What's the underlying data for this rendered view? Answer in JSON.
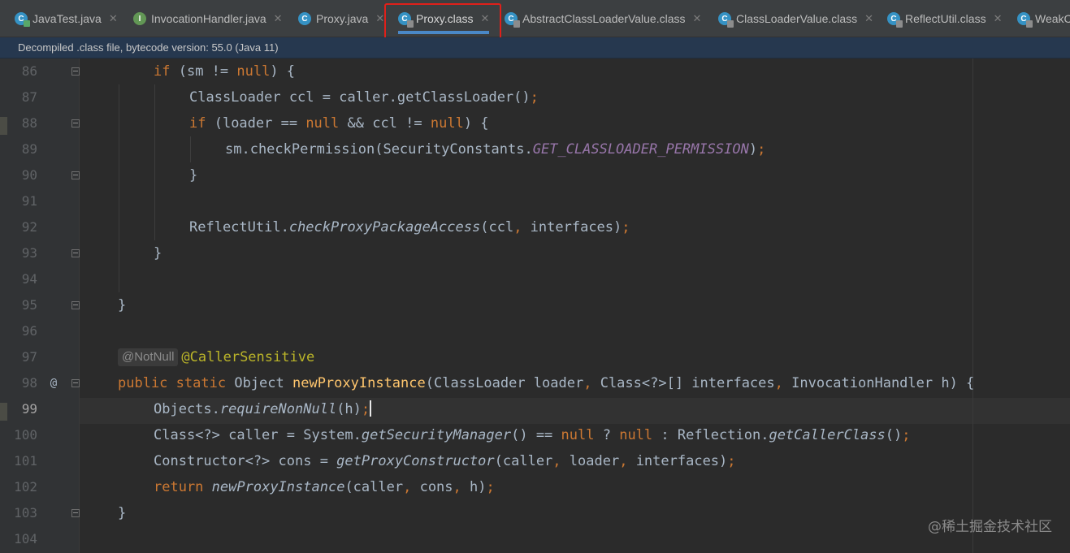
{
  "tabs": [
    {
      "label": "JavaTest.java",
      "icon": "class-file-icon"
    },
    {
      "label": "InvocationHandler.java",
      "icon": "interface-file-icon"
    },
    {
      "label": "Proxy.java",
      "icon": "class-file-icon"
    },
    {
      "label": "Proxy.class",
      "icon": "compiled-class-icon",
      "active": true
    },
    {
      "label": "AbstractClassLoaderValue.class",
      "icon": "compiled-class-icon"
    },
    {
      "label": "ClassLoaderValue.class",
      "icon": "compiled-class-icon"
    },
    {
      "label": "ReflectUtil.class",
      "icon": "compiled-class-icon"
    },
    {
      "label": "WeakC",
      "icon": "compiled-class-icon"
    }
  ],
  "banner": {
    "text": "Decompiled .class file, bytecode version: 55.0 (Java 11)"
  },
  "line_numbers": [
    "86",
    "87",
    "88",
    "89",
    "90",
    "91",
    "92",
    "93",
    "94",
    "95",
    "96",
    "97",
    "98",
    "99",
    "100",
    "101",
    "102",
    "103",
    "104"
  ],
  "current_line": "99",
  "gutter_marker": "@",
  "code": {
    "l86": {
      "kw_if": "if",
      "a": " (sm != ",
      "kw_null": "null",
      "b": ") {"
    },
    "l87": {
      "a": "ClassLoader ccl = caller.",
      "fn": "getClassLoader",
      "b": "()",
      "semi": ";"
    },
    "l88": {
      "kw_if": "if",
      "a": " (loader == ",
      "kw_null1": "null",
      "b": " && ccl != ",
      "kw_null2": "null",
      "c": ") {"
    },
    "l89": {
      "a": "sm.checkPermission(SecurityConstants.",
      "const": "GET_CLASSLOADER_PERMISSION",
      "b": ")",
      "semi": ";"
    },
    "l90": {
      "a": "}"
    },
    "l92": {
      "a": "ReflectUtil.",
      "fn": "checkProxyPackageAccess",
      "b": "(ccl",
      "comma": ",",
      "c": " interfaces)",
      "semi": ";"
    },
    "l93": {
      "a": "}"
    },
    "l95": {
      "a": "}"
    },
    "l97": {
      "hint": "@NotNull",
      "ann": "@CallerSensitive"
    },
    "l98": {
      "kw1": "public",
      "kw2": "static",
      "a": " Object ",
      "fn": "newProxyInstance",
      "b": "(ClassLoader loader",
      "c1": ",",
      "c": " Class<?>[] interfaces",
      "c2": ",",
      "d": " InvocationHandler h) {"
    },
    "l99": {
      "a": "Objects.",
      "fn": "requireNonNull",
      "b": "(h)",
      "semi": ";"
    },
    "l100": {
      "a": "Class<?> caller = System.",
      "fn": "getSecurityManager",
      "b": "() == ",
      "kw_null1": "null",
      "c": " ? ",
      "kw_null2": "null",
      "d": " : Reflection.",
      "fn2": "getCallerClass",
      "e": "()",
      "semi": ";"
    },
    "l101": {
      "a": "Constructor<?> cons = ",
      "fn": "getProxyConstructor",
      "b": "(caller",
      "c1": ",",
      "c": " loader",
      "c2": ",",
      "d": " interfaces)",
      "semi": ";"
    },
    "l102": {
      "kw": "return",
      "fn": "newProxyInstance",
      "b": "(caller",
      "c1": ",",
      "c": " cons",
      "c2": ",",
      "d": " h)",
      "semi": ";"
    },
    "l103": {
      "a": "}"
    }
  },
  "watermark": "@稀土掘金技术社区",
  "colors": {
    "keyword": "#cc7832",
    "method": "#ffc66d",
    "constant": "#9876aa",
    "annotation": "#bbb529",
    "text": "#a9b7c6",
    "highlight_box": "#e0201a"
  }
}
